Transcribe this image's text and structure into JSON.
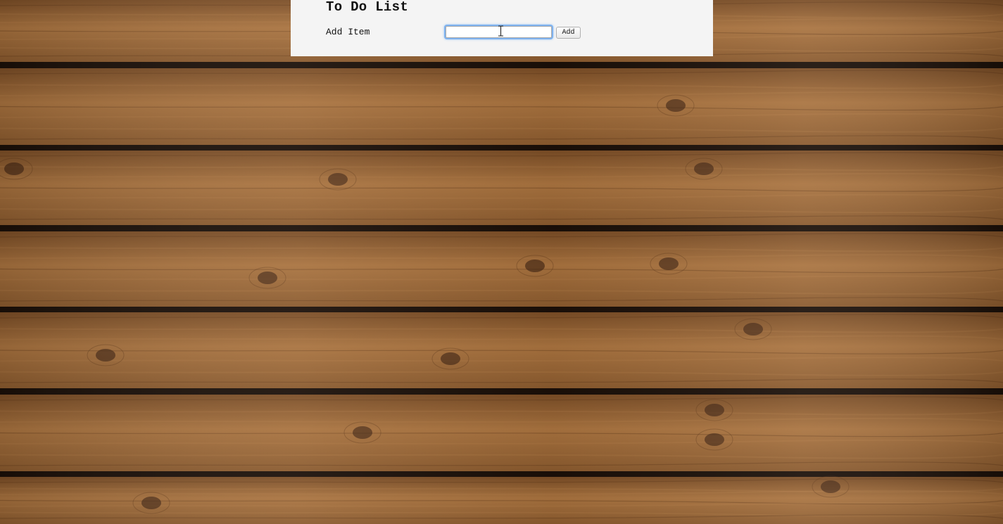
{
  "page": {
    "title": "To Do List"
  },
  "form": {
    "label": "Add Item",
    "input_value": "",
    "button_label": "Add"
  },
  "colors": {
    "panel_background": "#f4f4f4",
    "input_focus_ring": "#7fb3f0",
    "wood_base": "#8a5a2e",
    "wood_gap": "#1a0f08"
  },
  "icons": {
    "cursor": "text-cursor-icon"
  }
}
